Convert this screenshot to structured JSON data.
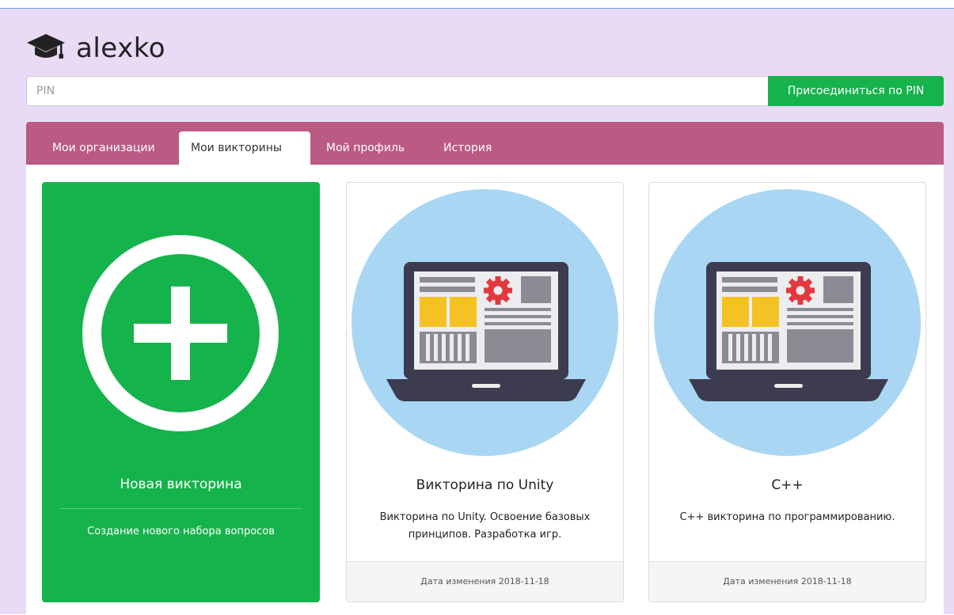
{
  "brand": {
    "name": "alexko",
    "icon": "graduation-cap-icon"
  },
  "pin": {
    "placeholder": "PIN",
    "value": "",
    "button_label": "Присоединиться по PIN"
  },
  "tabs": [
    {
      "label": "Мои организации",
      "active": false
    },
    {
      "label": "Мои викторины",
      "active": true
    },
    {
      "label": "Мой профиль",
      "active": false
    },
    {
      "label": "История",
      "active": false
    }
  ],
  "new_card": {
    "title": "Новая викторина",
    "description": "Создание нового набора вопросов",
    "icon": "plus-circle-icon"
  },
  "quizzes": [
    {
      "title": "Викторина по Unity",
      "description": "Викторина по Unity. Освоение базовых принципов. Разработка игр.",
      "modified": "Дата изменения 2018-11-18",
      "icon": "laptop-illustration-icon"
    },
    {
      "title": "C++",
      "description": "C++ викторина по программированию.",
      "modified": "Дата изменения 2018-11-18",
      "icon": "laptop-illustration-icon"
    }
  ],
  "colors": {
    "background": "#e9dbf6",
    "accent_green": "#15b34b",
    "tabs_bar": "#bb5a82",
    "illustration_circle": "#a9d7f3"
  }
}
